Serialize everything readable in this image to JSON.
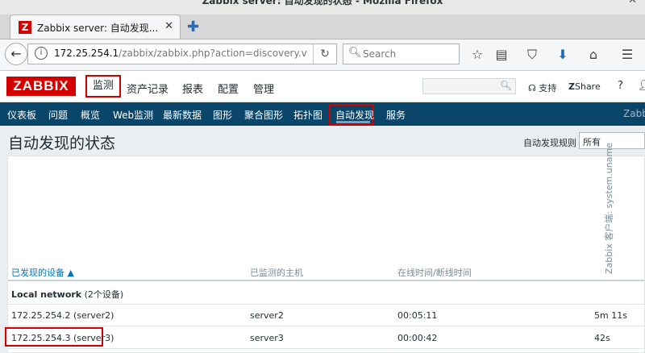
{
  "browser": {
    "window_title": "Zabbix server: 自动发现的状态 - Mozilla Firefox",
    "tab_title": "Zabbix server: 自动发现...",
    "url_host": "172.25.254.1",
    "url_path": "/zabbix/zabbix.php?action=discovery.v",
    "search_placeholder": "Search"
  },
  "zabbix": {
    "logo": "ZABBIX",
    "main_menu": [
      "监测",
      "资产记录",
      "报表",
      "配置",
      "管理"
    ],
    "header_links": {
      "support": "支持",
      "share": "Share",
      "help": "?"
    },
    "sub_menu": [
      "仪表板",
      "问题",
      "概览",
      "Web监测",
      "最新数据",
      "图形",
      "聚合图形",
      "拓扑图",
      "自动发现",
      "服务",
      "Zabb"
    ],
    "page_title": "自动发现的状态",
    "filter": {
      "label": "自动发现规则",
      "value": "所有"
    },
    "table": {
      "columns": [
        "已发现的设备 ▲",
        "已监测的主机",
        "在线时间/断线时间"
      ],
      "vertical_column": "Zabbix 客户端: system.uname",
      "group": {
        "name": "Local network",
        "count": "(2个设备)"
      },
      "rows": [
        {
          "device": "172.25.254.2 (server2)",
          "host": "server2",
          "uptime": "00:05:11",
          "value": "5m 11s"
        },
        {
          "device": "172.25.254.3 (server3)",
          "host": "server3",
          "uptime": "00:00:42",
          "value": "42s"
        }
      ]
    }
  },
  "colors": {
    "brand": "#d40000",
    "submenu_bg": "#0a466a",
    "highlight": "#d40000",
    "link": "#0275b8"
  }
}
